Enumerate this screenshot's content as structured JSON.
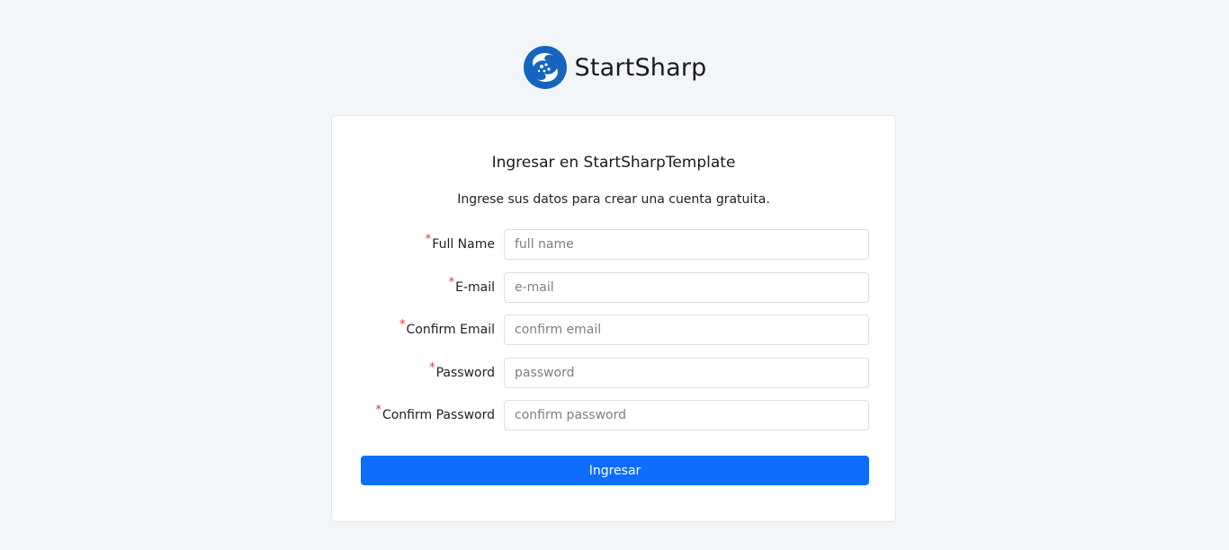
{
  "brand": {
    "name": "StartSharp",
    "logo_icon": "startsharp-logo-icon",
    "logo_color": "#1565c0"
  },
  "card": {
    "title": "Ingresar en StartSharpTemplate",
    "subtitle": "Ingrese sus datos para crear una cuenta gratuita."
  },
  "form": {
    "required_marker": "*",
    "fields": [
      {
        "label": "Full Name",
        "placeholder": "full name",
        "value": ""
      },
      {
        "label": "E-mail",
        "placeholder": "e-mail",
        "value": ""
      },
      {
        "label": "Confirm Email",
        "placeholder": "confirm email",
        "value": ""
      },
      {
        "label": "Password",
        "placeholder": "password",
        "value": ""
      },
      {
        "label": "Confirm Password",
        "placeholder": "confirm password",
        "value": ""
      }
    ],
    "submit_label": "Ingresar"
  },
  "colors": {
    "background": "#f3f6f9",
    "primary": "#0d6efd",
    "required": "#e53935"
  }
}
